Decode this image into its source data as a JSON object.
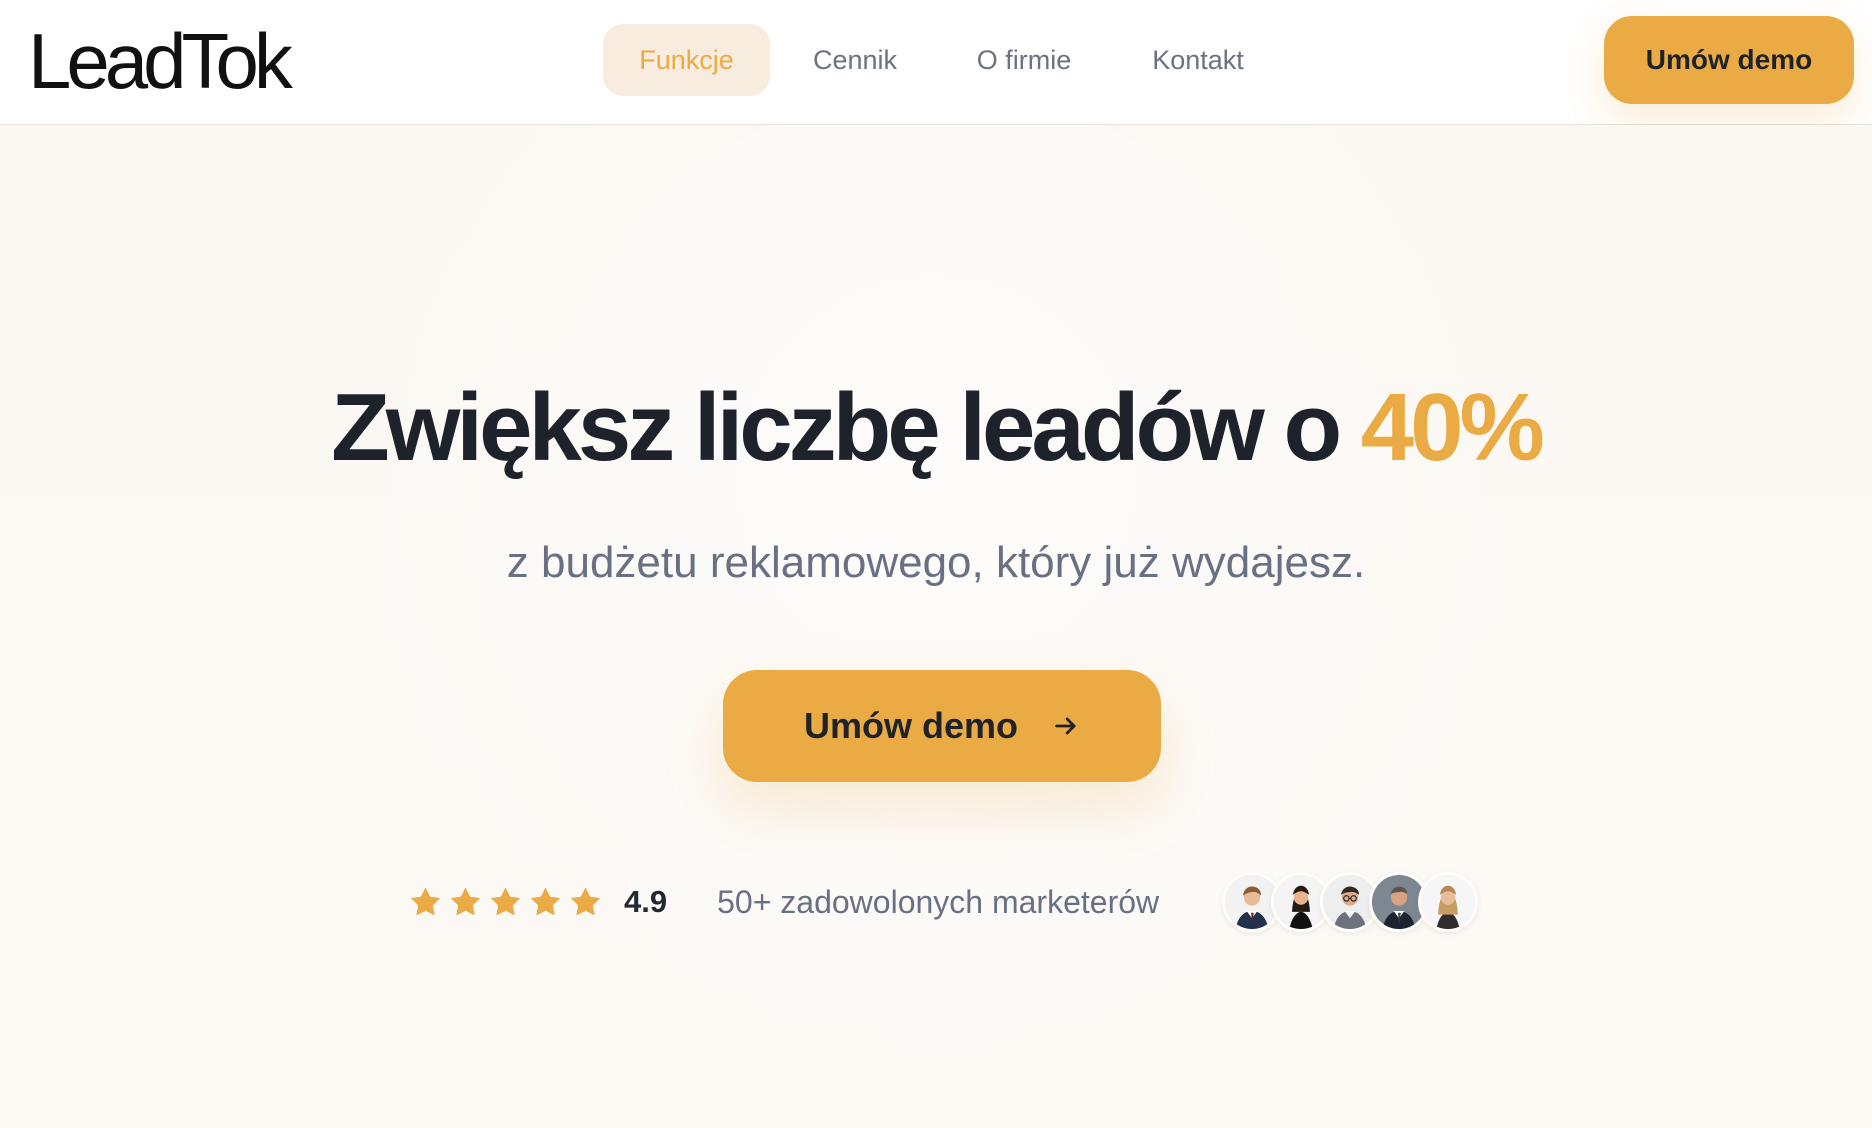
{
  "brand": {
    "name": "LeadTok"
  },
  "nav": {
    "items": [
      {
        "label": "Funkcje",
        "active": true
      },
      {
        "label": "Cennik",
        "active": false
      },
      {
        "label": "O firmie",
        "active": false
      },
      {
        "label": "Kontakt",
        "active": false
      }
    ],
    "cta_label": "Umów demo"
  },
  "hero": {
    "headline_main": "Zwiększ liczbę leadów o ",
    "headline_accent": "40%",
    "subtitle": "z budżetu reklamowego, który już wydajesz.",
    "cta_label": "Umów demo",
    "cta_icon": "arrow-right-icon"
  },
  "social_proof": {
    "stars": 5,
    "rating": "4.9",
    "happy_marketers": "50+ zadowolonych marketerów",
    "avatars": [
      "avatar-man-1",
      "avatar-woman-1",
      "avatar-man-2",
      "avatar-man-3",
      "avatar-woman-2"
    ]
  },
  "colors": {
    "accent": "#eaab45",
    "text_dark": "#1d222b",
    "text_muted": "#687183",
    "nav_active_bg": "#f7ecdd",
    "background": "#fbf8f3"
  }
}
